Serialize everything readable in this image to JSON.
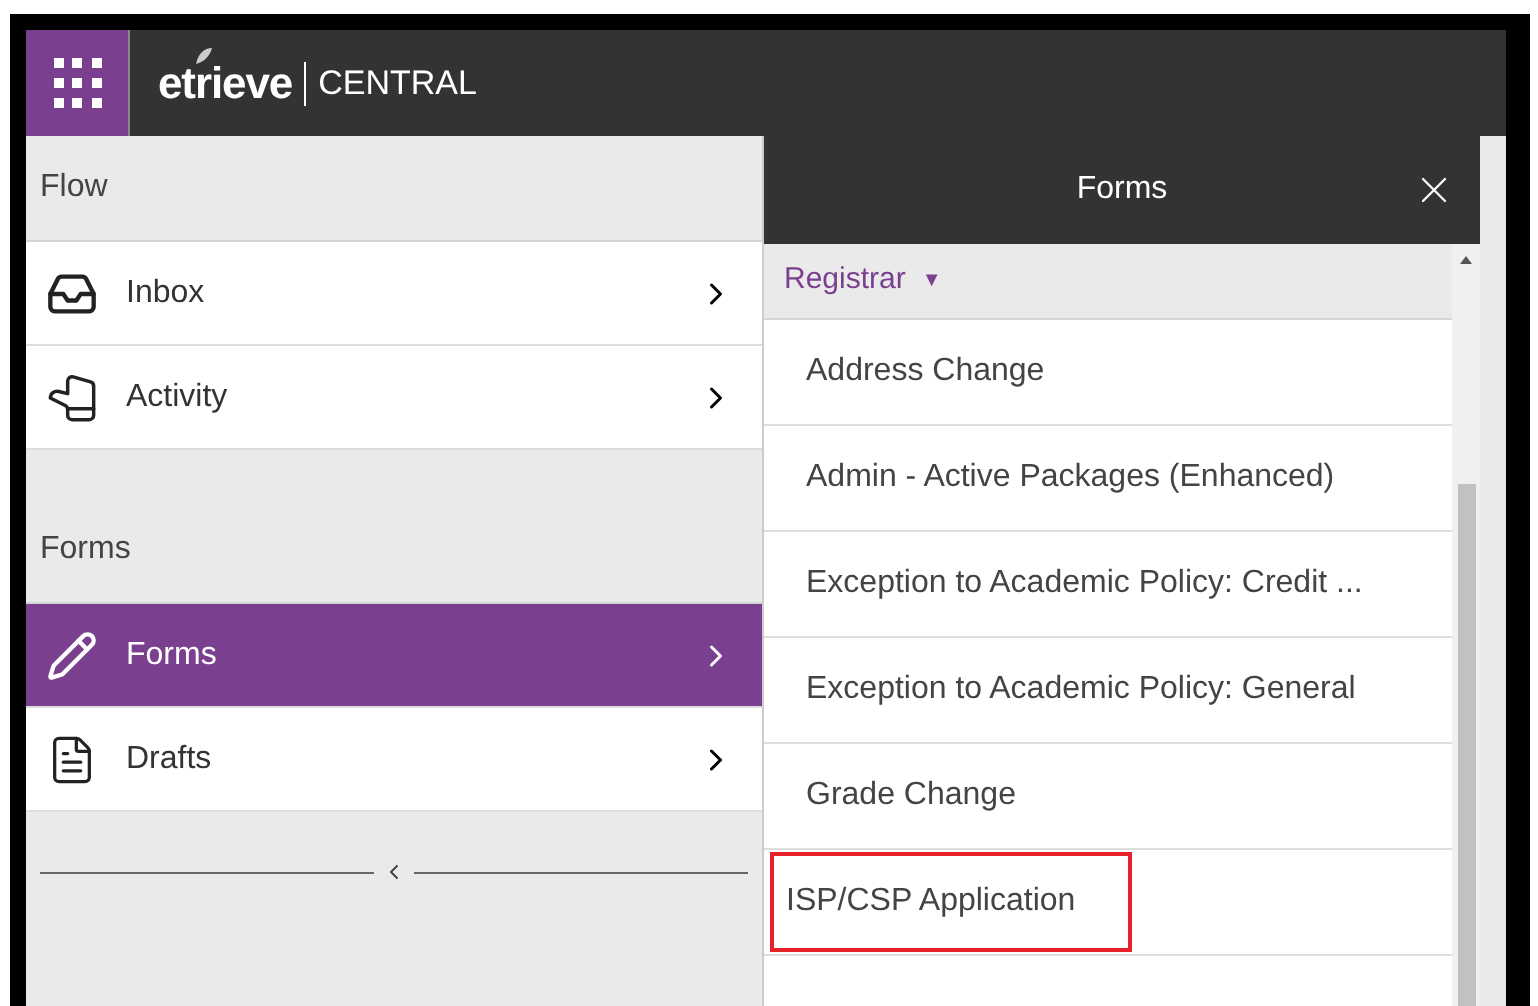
{
  "header": {
    "logo": "etrieve",
    "product": "CENTRAL"
  },
  "sidebar": {
    "sections": [
      {
        "title": "Flow",
        "items": [
          {
            "label": "Inbox",
            "kind": "inbox",
            "selected": false
          },
          {
            "label": "Activity",
            "kind": "hand",
            "selected": false
          }
        ]
      },
      {
        "title": "Forms",
        "items": [
          {
            "label": "Forms",
            "kind": "pencil",
            "selected": true
          },
          {
            "label": "Drafts",
            "kind": "document",
            "selected": false
          }
        ]
      }
    ]
  },
  "forms_panel": {
    "title": "Forms",
    "group": {
      "label": "Registrar",
      "caret": "▼"
    },
    "items": [
      {
        "label": "Address Change",
        "highlighted": false
      },
      {
        "label": "Admin - Active Packages (Enhanced)",
        "highlighted": false
      },
      {
        "label": "Exception to Academic Policy: Credit ...",
        "highlighted": false
      },
      {
        "label": "Exception to Academic Policy: General",
        "highlighted": false
      },
      {
        "label": "Grade Change",
        "highlighted": false
      },
      {
        "label": "ISP/CSP Application",
        "highlighted": true
      }
    ]
  }
}
